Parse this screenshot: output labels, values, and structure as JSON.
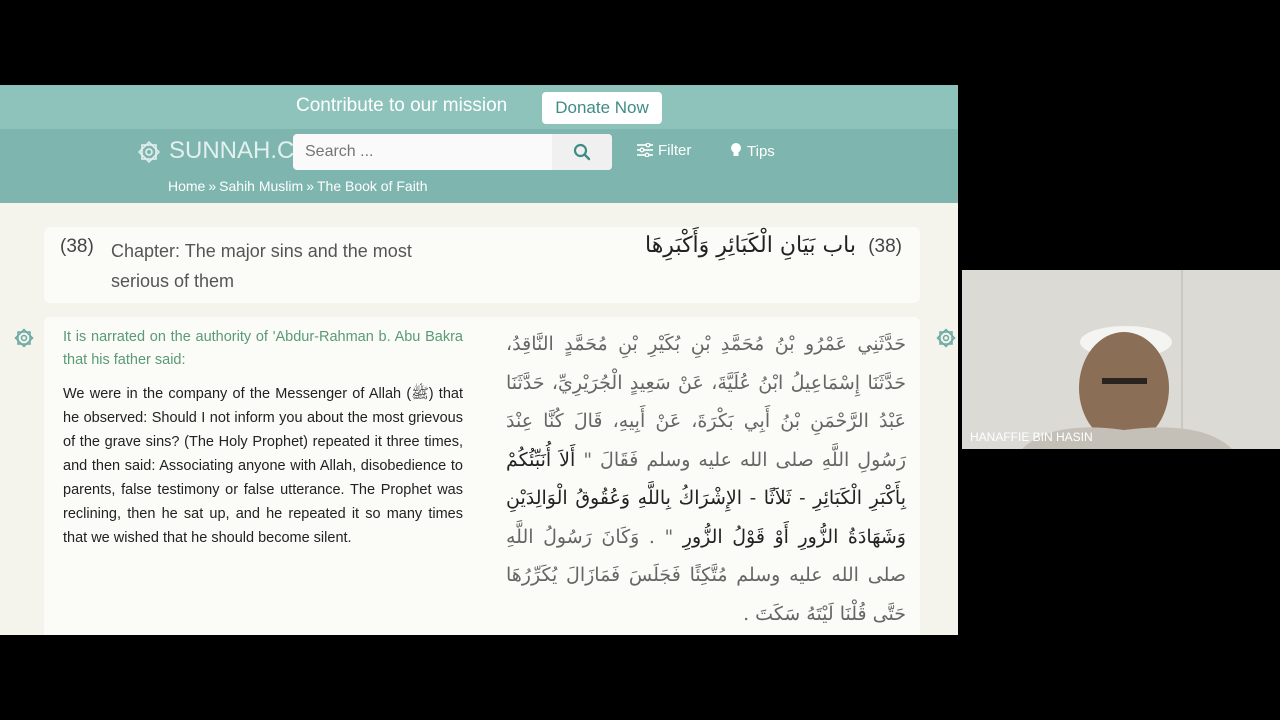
{
  "banner": {
    "text": "Contribute to our mission",
    "donate_label": "Donate Now"
  },
  "nav": {
    "logo_text": "SUNNAH.C",
    "search_placeholder": "Search ...",
    "filter_label": "Filter",
    "tips_label": "Tips"
  },
  "breadcrumb": {
    "home": "Home",
    "collection": "Sahih Muslim",
    "book": "The Book of Faith",
    "separator": "»"
  },
  "chapter": {
    "number": "(38)",
    "title_en": "Chapter: The major sins and the most serious of them",
    "title_ar": "باب بَيَانِ الْكَبَائِرِ وَأَكْبَرِهَا",
    "number_ar": "(38)"
  },
  "hadith": {
    "narrator": "It is narrated on the authority of 'Abdur-Rahman b. Abu Bakra that his father said:",
    "text_en": "We were in the company of the Messenger of Allah (ﷺ) that he observed: Should I not inform you about the most grievous of the grave sins? (The Holy Prophet) repeated it three times, and then said: Associating anyone with Allah, disobedience to parents, false testimony or false utterance. The Prophet was reclining, then he sat up, and he repeated it so many times that we wished that he should become silent.",
    "text_ar_1": "حَدَّثَنِي عَمْرُو بْنُ مُحَمَّدِ بْنِ بُكَيْرِ بْنِ مُحَمَّدٍ النَّاقِدُ، حَدَّثَنَا إِسْمَاعِيلُ ابْنُ عُلَيَّةَ، عَنْ سَعِيدٍ الْجُرَيْرِيِّ، حَدَّثَنَا عَبْدُ الرَّحْمَنِ بْنُ أَبِي بَكْرَةَ، عَنْ أَبِيهِ، قَالَ كُنَّا عِنْدَ رَسُولِ اللَّهِ صلى الله عليه وسلم فَقَالَ \"",
    "text_ar_2": "أَلاَ أُنَبِّئُكُمْ بِأَكْبَرِ الْكَبَائِرِ - ثَلاَثًا - الإِشْرَاكُ بِاللَّهِ وَعُقُوقُ الْوَالِدَيْنِ وَشَهَادَةُ الزُّورِ أَوْ قَوْلُ الزُّورِ",
    "text_ar_3": "\" . وَكَانَ رَسُولُ اللَّهِ صلى الله عليه وسلم مُتَّكِئًا فَجَلَسَ فَمَازَالَ يُكَرِّرُهَا حَتَّى قُلْنَا لَيْتَهُ سَكَتَ ."
  },
  "webcam": {
    "participant_name": "HANAFFIE BIN HASIN"
  },
  "colors": {
    "banner": "#8ec3bc",
    "navbar": "#7eb6af",
    "narrator": "#5a9a74",
    "page_bg": "#f4f3ec"
  }
}
